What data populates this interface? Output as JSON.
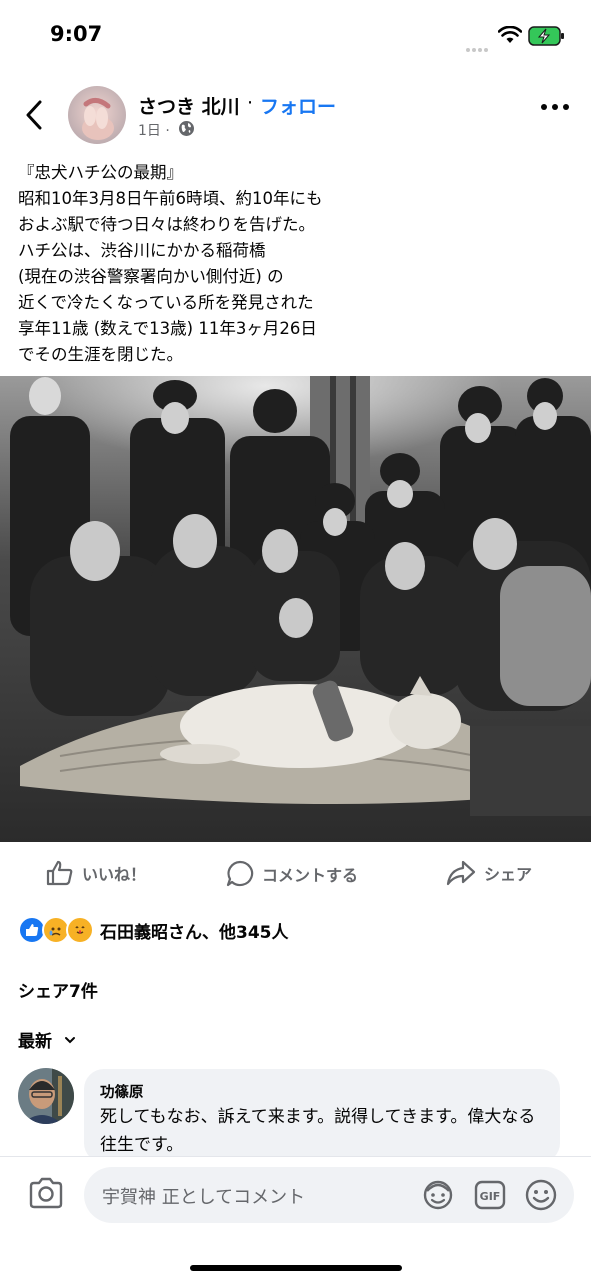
{
  "status_bar": {
    "time": "9:07"
  },
  "post": {
    "author": "さつき 北川",
    "follow_label": "フォロー",
    "separator": "·",
    "age": "1日 ·",
    "text": "『忠犬ハチ公の最期』\n昭和10年3月8日午前6時頃、約10年にも\nおよぶ駅で待つ日々は終わりを告げた。\nハチ公は、渋谷川にかかる稲荷橋\n(現在の渋谷警察署向かい側付近) の\n近くで冷たくなっている所を発見された\n享年11歳 (数えで13歳) 11年3ヶ月26日\nでその生涯を閉じた。"
  },
  "actions": {
    "like_label": "いいね！",
    "comment_label": "コメントする",
    "share_label": "シェア"
  },
  "engagement": {
    "reactions_text": "石田義昭さん、他345人",
    "reaction_icons": [
      "like-icon",
      "sad-icon",
      "care-icon"
    ],
    "shares_text": "シェア7件",
    "sort_label": "最新"
  },
  "comments": [
    {
      "author": "功篠原",
      "text": "死してもなお、訴えて来ます。説得してきます。偉大なる往生です。"
    }
  ],
  "composer": {
    "placeholder": "宇賀神 正としてコメント"
  },
  "colors": {
    "accent": "#1877f2",
    "secondary_text": "#65676b",
    "bubble": "#f0f2f5"
  }
}
